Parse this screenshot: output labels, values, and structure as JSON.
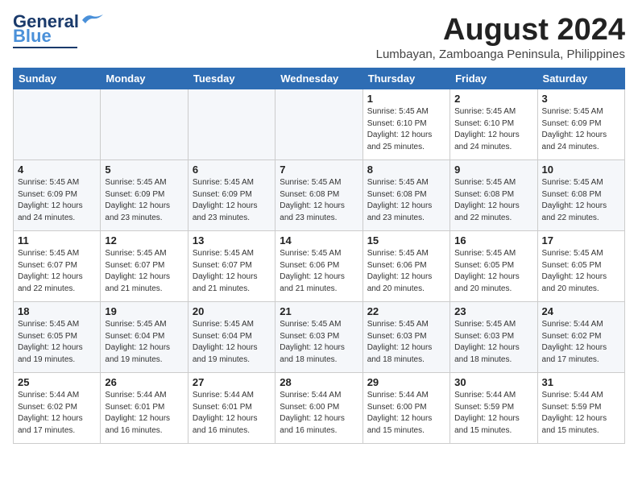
{
  "logo": {
    "text_general": "General",
    "text_blue": "Blue",
    "tagline": ""
  },
  "header": {
    "title": "August 2024",
    "subtitle": "Lumbayan, Zamboanga Peninsula, Philippines"
  },
  "weekdays": [
    "Sunday",
    "Monday",
    "Tuesday",
    "Wednesday",
    "Thursday",
    "Friday",
    "Saturday"
  ],
  "weeks": [
    [
      {
        "day": "",
        "info": ""
      },
      {
        "day": "",
        "info": ""
      },
      {
        "day": "",
        "info": ""
      },
      {
        "day": "",
        "info": ""
      },
      {
        "day": "1",
        "info": "Sunrise: 5:45 AM\nSunset: 6:10 PM\nDaylight: 12 hours\nand 25 minutes."
      },
      {
        "day": "2",
        "info": "Sunrise: 5:45 AM\nSunset: 6:10 PM\nDaylight: 12 hours\nand 24 minutes."
      },
      {
        "day": "3",
        "info": "Sunrise: 5:45 AM\nSunset: 6:09 PM\nDaylight: 12 hours\nand 24 minutes."
      }
    ],
    [
      {
        "day": "4",
        "info": "Sunrise: 5:45 AM\nSunset: 6:09 PM\nDaylight: 12 hours\nand 24 minutes."
      },
      {
        "day": "5",
        "info": "Sunrise: 5:45 AM\nSunset: 6:09 PM\nDaylight: 12 hours\nand 23 minutes."
      },
      {
        "day": "6",
        "info": "Sunrise: 5:45 AM\nSunset: 6:09 PM\nDaylight: 12 hours\nand 23 minutes."
      },
      {
        "day": "7",
        "info": "Sunrise: 5:45 AM\nSunset: 6:08 PM\nDaylight: 12 hours\nand 23 minutes."
      },
      {
        "day": "8",
        "info": "Sunrise: 5:45 AM\nSunset: 6:08 PM\nDaylight: 12 hours\nand 23 minutes."
      },
      {
        "day": "9",
        "info": "Sunrise: 5:45 AM\nSunset: 6:08 PM\nDaylight: 12 hours\nand 22 minutes."
      },
      {
        "day": "10",
        "info": "Sunrise: 5:45 AM\nSunset: 6:08 PM\nDaylight: 12 hours\nand 22 minutes."
      }
    ],
    [
      {
        "day": "11",
        "info": "Sunrise: 5:45 AM\nSunset: 6:07 PM\nDaylight: 12 hours\nand 22 minutes."
      },
      {
        "day": "12",
        "info": "Sunrise: 5:45 AM\nSunset: 6:07 PM\nDaylight: 12 hours\nand 21 minutes."
      },
      {
        "day": "13",
        "info": "Sunrise: 5:45 AM\nSunset: 6:07 PM\nDaylight: 12 hours\nand 21 minutes."
      },
      {
        "day": "14",
        "info": "Sunrise: 5:45 AM\nSunset: 6:06 PM\nDaylight: 12 hours\nand 21 minutes."
      },
      {
        "day": "15",
        "info": "Sunrise: 5:45 AM\nSunset: 6:06 PM\nDaylight: 12 hours\nand 20 minutes."
      },
      {
        "day": "16",
        "info": "Sunrise: 5:45 AM\nSunset: 6:05 PM\nDaylight: 12 hours\nand 20 minutes."
      },
      {
        "day": "17",
        "info": "Sunrise: 5:45 AM\nSunset: 6:05 PM\nDaylight: 12 hours\nand 20 minutes."
      }
    ],
    [
      {
        "day": "18",
        "info": "Sunrise: 5:45 AM\nSunset: 6:05 PM\nDaylight: 12 hours\nand 19 minutes."
      },
      {
        "day": "19",
        "info": "Sunrise: 5:45 AM\nSunset: 6:04 PM\nDaylight: 12 hours\nand 19 minutes."
      },
      {
        "day": "20",
        "info": "Sunrise: 5:45 AM\nSunset: 6:04 PM\nDaylight: 12 hours\nand 19 minutes."
      },
      {
        "day": "21",
        "info": "Sunrise: 5:45 AM\nSunset: 6:03 PM\nDaylight: 12 hours\nand 18 minutes."
      },
      {
        "day": "22",
        "info": "Sunrise: 5:45 AM\nSunset: 6:03 PM\nDaylight: 12 hours\nand 18 minutes."
      },
      {
        "day": "23",
        "info": "Sunrise: 5:45 AM\nSunset: 6:03 PM\nDaylight: 12 hours\nand 18 minutes."
      },
      {
        "day": "24",
        "info": "Sunrise: 5:44 AM\nSunset: 6:02 PM\nDaylight: 12 hours\nand 17 minutes."
      }
    ],
    [
      {
        "day": "25",
        "info": "Sunrise: 5:44 AM\nSunset: 6:02 PM\nDaylight: 12 hours\nand 17 minutes."
      },
      {
        "day": "26",
        "info": "Sunrise: 5:44 AM\nSunset: 6:01 PM\nDaylight: 12 hours\nand 16 minutes."
      },
      {
        "day": "27",
        "info": "Sunrise: 5:44 AM\nSunset: 6:01 PM\nDaylight: 12 hours\nand 16 minutes."
      },
      {
        "day": "28",
        "info": "Sunrise: 5:44 AM\nSunset: 6:00 PM\nDaylight: 12 hours\nand 16 minutes."
      },
      {
        "day": "29",
        "info": "Sunrise: 5:44 AM\nSunset: 6:00 PM\nDaylight: 12 hours\nand 15 minutes."
      },
      {
        "day": "30",
        "info": "Sunrise: 5:44 AM\nSunset: 5:59 PM\nDaylight: 12 hours\nand 15 minutes."
      },
      {
        "day": "31",
        "info": "Sunrise: 5:44 AM\nSunset: 5:59 PM\nDaylight: 12 hours\nand 15 minutes."
      }
    ]
  ]
}
